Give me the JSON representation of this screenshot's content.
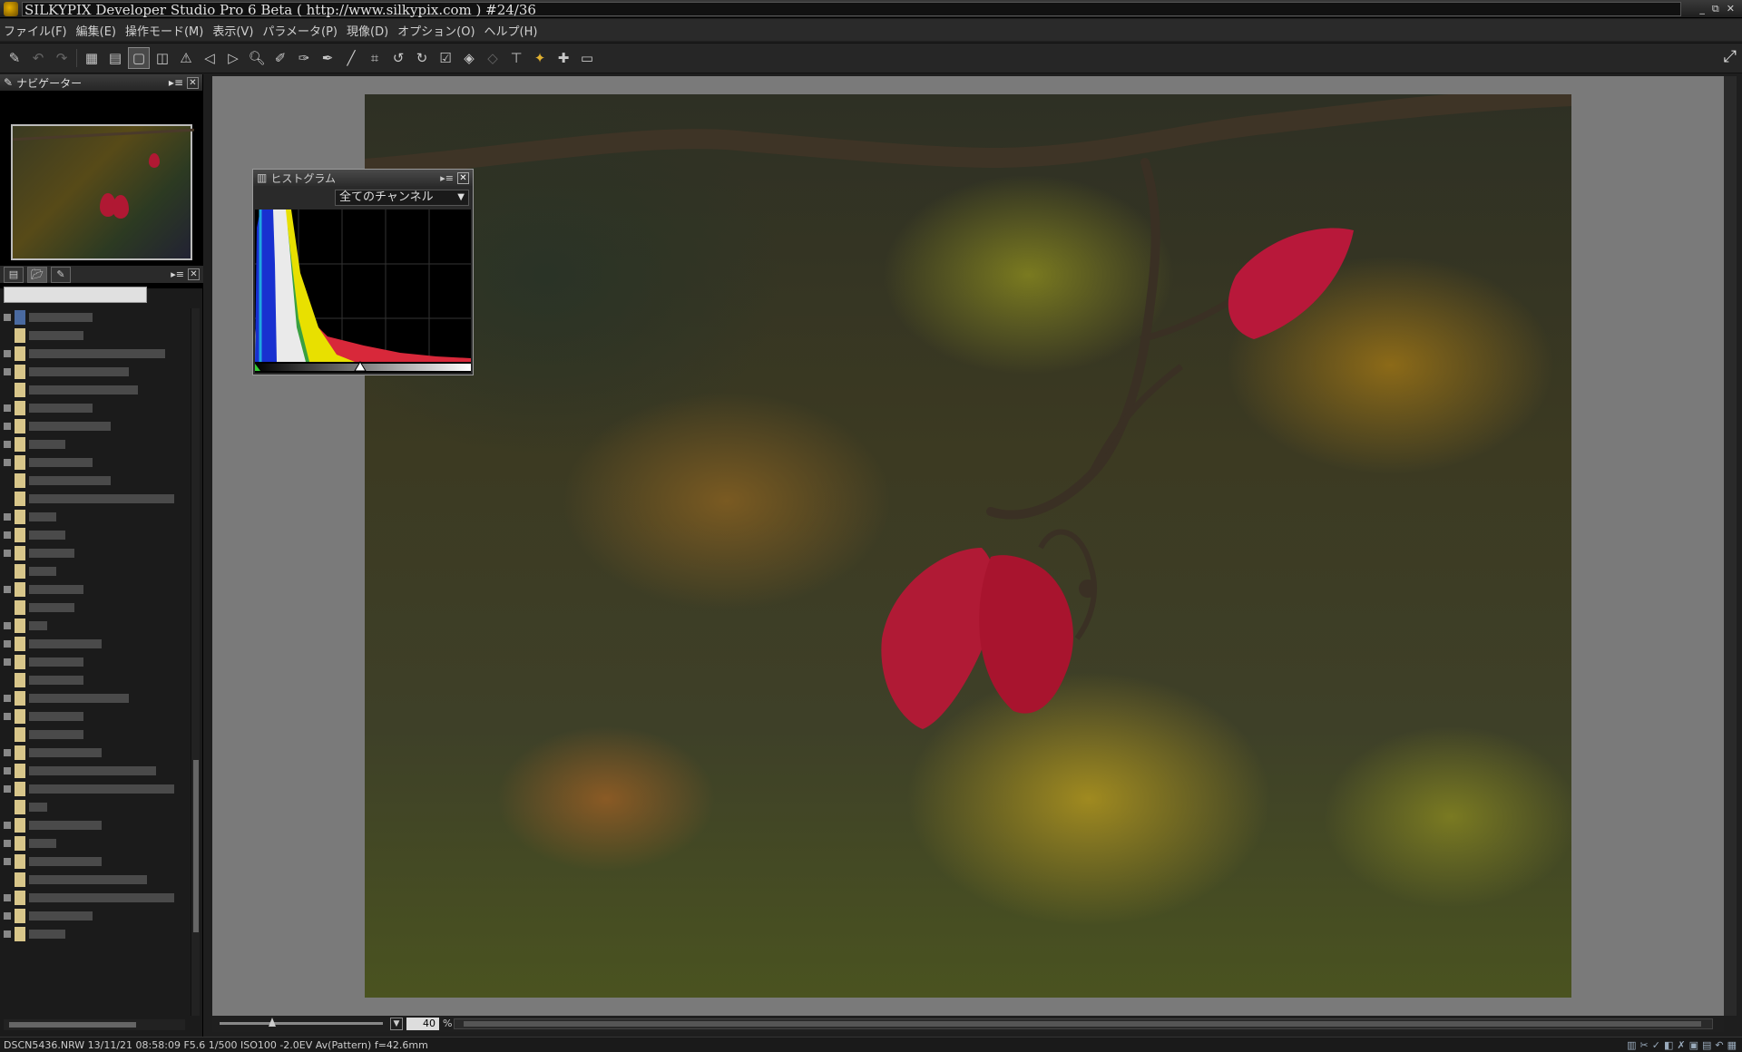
{
  "window": {
    "title": "SILKYPIX Developer Studio Pro 6 Beta ( http://www.silkypix.com )   #24/36",
    "controls": [
      "_",
      "⧉",
      "✕"
    ]
  },
  "menu": [
    "ファイル(F)",
    "編集(E)",
    "操作モード(M)",
    "表示(V)",
    "パラメータ(P)",
    "現像(D)",
    "オプション(O)",
    "ヘルプ(H)"
  ],
  "navigator": {
    "title": "ナビゲーター"
  },
  "histogram": {
    "title": "ヒストグラム",
    "channel": "全てのチャンネル"
  },
  "zoom": {
    "value": "40",
    "unit": "%"
  },
  "status": {
    "text": "DSCN5436.NRW 13/11/21 08:58:09 F5.6  1/500   ISO100 -2.0EV Av(Pattern) f=42.6mm"
  },
  "colors": {
    "leaf": "#b8183a",
    "branch": "#3e3426"
  }
}
